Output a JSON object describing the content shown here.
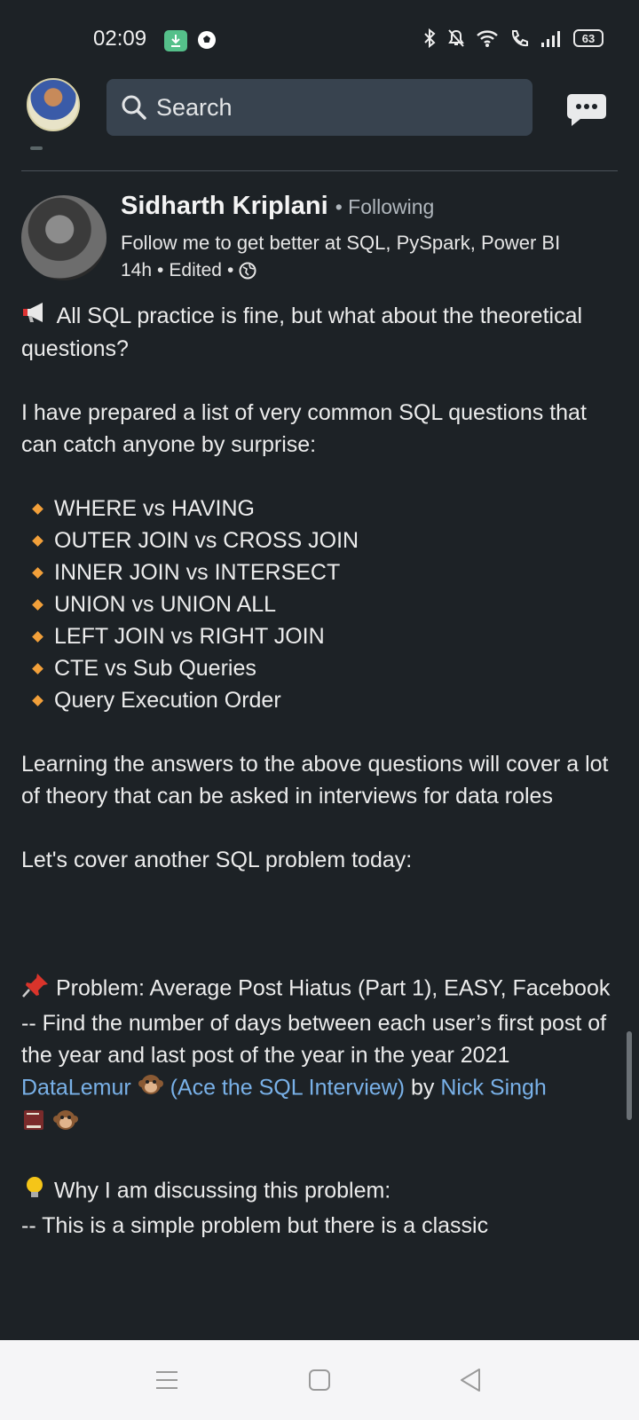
{
  "status_bar": {
    "time": "02:09",
    "battery": "63",
    "icons": [
      "download-icon",
      "football-icon",
      "bluetooth-icon",
      "mute-icon",
      "wifi-icon",
      "call-icon",
      "signal-icon",
      "battery-icon"
    ]
  },
  "topbar": {
    "search_placeholder": "Search"
  },
  "post": {
    "author": {
      "name": "Sidharth Kriplani",
      "relation": "Following",
      "headline": "Follow me to get better at SQL, PySpark, Power BI",
      "time": "14h",
      "edited": "Edited"
    },
    "intro_line1": "All SQL practice is fine, but what about the theoretical questions?",
    "intro_line2": "I have prepared a list of very common SQL questions that can catch anyone by surprise:",
    "bullets": [
      "WHERE vs HAVING",
      "OUTER JOIN vs CROSS JOIN",
      "INNER JOIN vs INTERSECT",
      "UNION vs UNION ALL",
      "LEFT JOIN vs RIGHT JOIN",
      "CTE vs Sub Queries",
      "Query Execution Order"
    ],
    "learning": "Learning the answers to the above questions will cover a lot of theory that can be asked in interviews for data roles",
    "another": "Let's cover another SQL problem today:",
    "problem_title": "Problem: Average Post Hiatus (Part 1), EASY, Facebook",
    "problem_desc": "-- Find the number of days between each user’s first post of the year and last post of the year in the year 2021",
    "credit": {
      "link1": "DataLemur",
      "link2": "(Ace the SQL Interview)",
      "by": "by",
      "link3": "Nick Singh"
    },
    "why_title": "Why I am discussing this problem:",
    "why_desc": "-- This is a simple problem but there is a classic"
  }
}
